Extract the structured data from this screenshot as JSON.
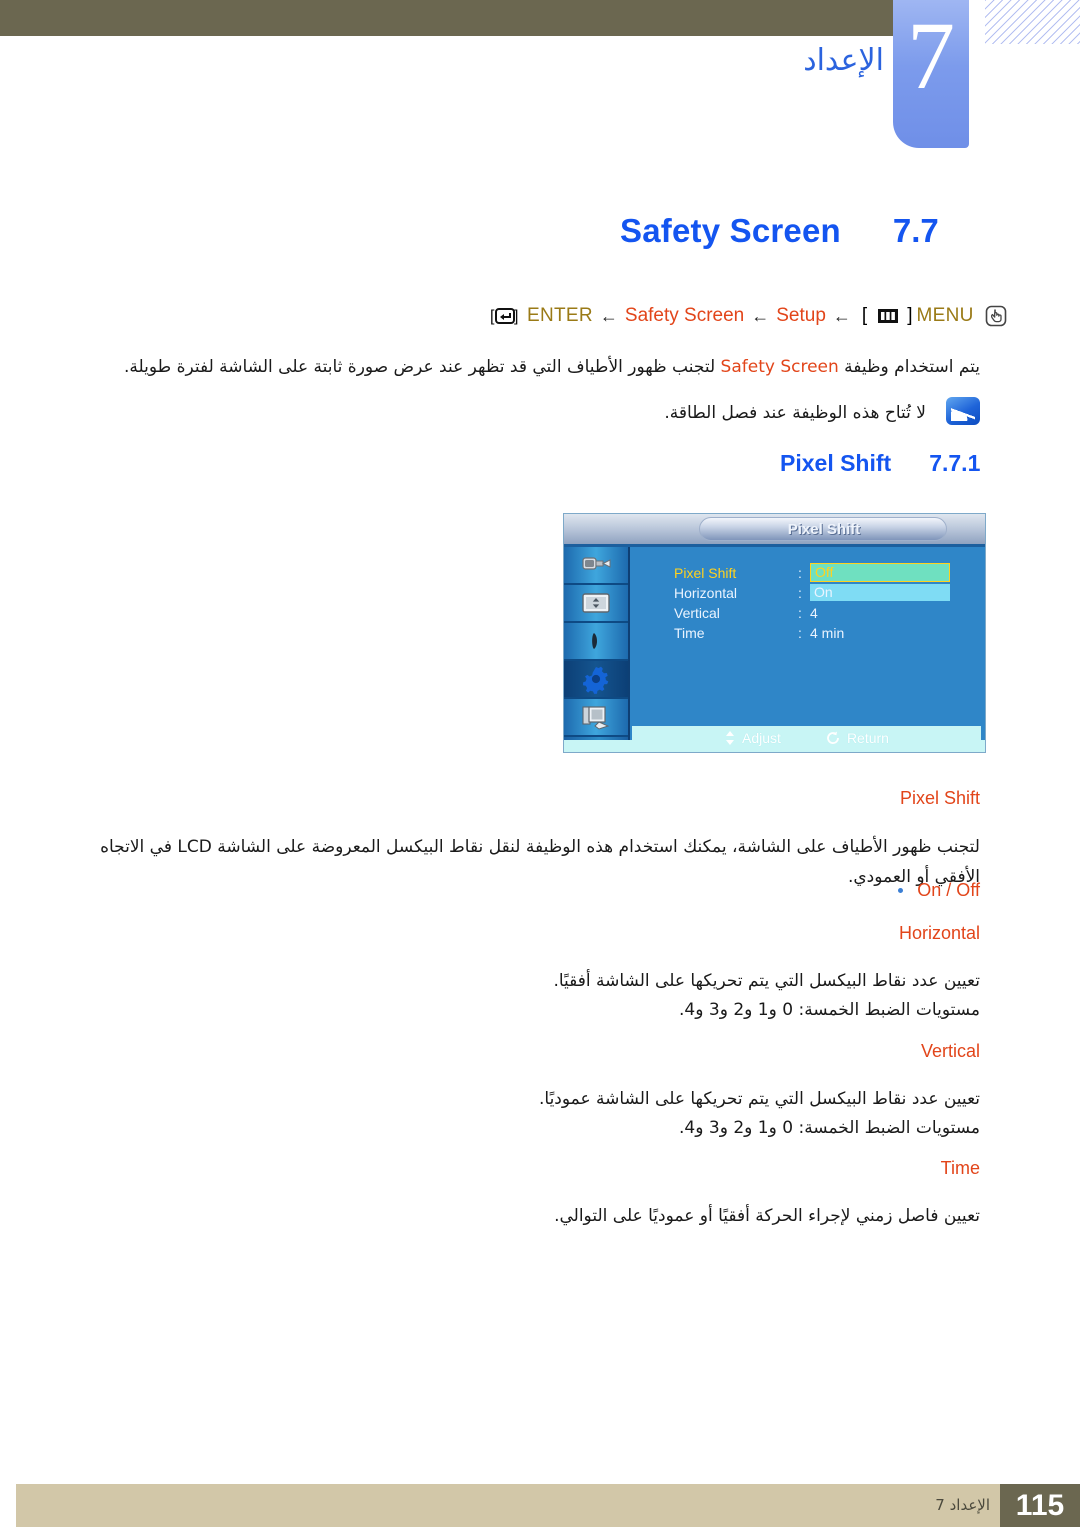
{
  "header": {
    "chapter_number": "7",
    "chapter_title": "الإعداد"
  },
  "section": {
    "title": "Safety Screen",
    "number": "7.7"
  },
  "breadcrumb": {
    "enter_icon": "enter-key-icon",
    "enter_label": "ENTER",
    "arrow1": "←",
    "item_safety_screen": "Safety Screen",
    "arrow2": "←",
    "item_setup": "Setup",
    "arrow3": "←",
    "menu_bracket_open": "[",
    "menu_icon": "menu-bars-icon",
    "menu_bracket_close": "]",
    "menu_label": "MENU",
    "hand_icon": "hand-press-button-icon"
  },
  "intro": {
    "text_before": "يتم استخدام وظيفة ",
    "highlight": "Safety Screen",
    "text_after": " لتجنب ظهور الأطياف التي قد تظهر عند عرض صورة ثابتة على الشاشة لفترة طويلة.",
    "note": "لا تُتاح هذه الوظيفة عند فصل الطاقة.",
    "note_icon": "note-info-icon"
  },
  "subsection": {
    "title": "Pixel Shift",
    "number": "7.7.1"
  },
  "osd": {
    "window_title": "Pixel Shift",
    "sidebar_icons": [
      "picture-roller-icon",
      "screen-adjust-icon",
      "sound-icon",
      "setup-gear-icon",
      "multi-control-icon"
    ],
    "selected_sidebar_index": 3,
    "rows": [
      {
        "label": "Pixel Shift",
        "colon": ":",
        "value": "Off",
        "style": "chip-green",
        "active": true
      },
      {
        "label": "Horizontal",
        "colon": ":",
        "value": "On",
        "style": "chip-cyan",
        "active": false
      },
      {
        "label": "Vertical",
        "colon": ":",
        "value": "4",
        "style": "plain",
        "active": false
      },
      {
        "label": "Time",
        "colon": ":",
        "value": "4 min",
        "style": "plain",
        "active": false
      }
    ],
    "hints": [
      {
        "icon": "up-down-arrows-icon",
        "label": "Adjust"
      },
      {
        "icon": "return-arrow-icon",
        "label": "Return"
      }
    ]
  },
  "items": [
    {
      "heading": "Pixel Shift",
      "body": "لتجنب ظهور الأطياف على الشاشة، يمكنك استخدام هذه الوظيفة لنقل نقاط البيكسل المعروضة على الشاشة LCD في الاتجاه الأفقي أو العمودي.",
      "bullet": "On / Off"
    },
    {
      "heading": "Horizontal",
      "body_line1": "تعيين عدد نقاط البيكسل التي يتم تحريكها على الشاشة أفقيًا.",
      "body_line2": "مستويات الضبط الخمسة: 0 و1 و2 و3 و4."
    },
    {
      "heading": "Vertical",
      "body_line1": "تعيين عدد نقاط البيكسل التي يتم تحريكها على الشاشة عموديًا.",
      "body_line2": "مستويات الضبط الخمسة: 0 و1 و2 و3 و4."
    },
    {
      "heading": "Time",
      "body_line1": "تعيين فاصل زمني لإجراء الحركة أفقيًا أو عموديًا على التوالي."
    }
  ],
  "footer": {
    "label": "الإعداد 7",
    "page_number": "115"
  },
  "colors": {
    "olive": "#6b6750",
    "tan": "#d2c7a8",
    "heading_blue": "#1455f0",
    "accent_orange": "#e2451a",
    "breadcrumb_gold": "#9a7a16",
    "osd_blue": "#2f86c8"
  }
}
